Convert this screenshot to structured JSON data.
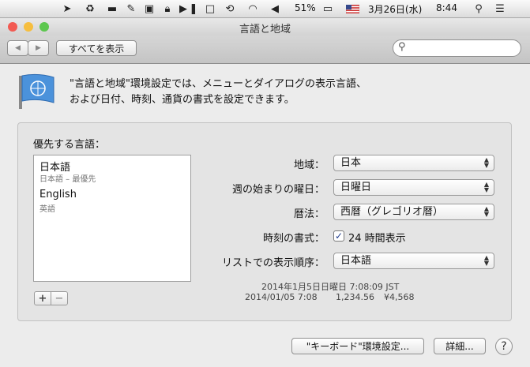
{
  "menubar": {
    "battery": "51%",
    "date": "3月26日(水)",
    "time": "8:44"
  },
  "window": {
    "title": "言語と地域"
  },
  "toolbar": {
    "show_all": "すべてを表示",
    "back_icon": "◀",
    "forward_icon": "▶"
  },
  "intro": {
    "line1": "\"言語と地域\"環境設定では、メニューとダイアログの表示言語、",
    "line2": "および日付、時刻、通貨の書式を設定できます。"
  },
  "languages": {
    "heading": "優先する言語：",
    "items": [
      {
        "name": "日本語",
        "sub": "日本語 – 最優先"
      },
      {
        "name": "English",
        "sub": "英語"
      }
    ],
    "add": "+",
    "remove": "−"
  },
  "settings": {
    "region_label": "地域：",
    "region_value": "日本",
    "week_label": "週の始まりの曜日：",
    "week_value": "日曜日",
    "calendar_label": "暦法：",
    "calendar_value": "西暦（グレゴリオ暦）",
    "time_format_label": "時刻の書式：",
    "time_format_value": "24 時間表示",
    "time_format_checked": true,
    "list_order_label": "リストでの表示順序：",
    "list_order_value": "日本語"
  },
  "sample": {
    "line1": "2014年1月5日日曜日 7:08:09 JST",
    "line2_date": "2014/01/05 7:08",
    "line2_number": "1,234.56",
    "line2_currency": "¥4,568"
  },
  "buttons": {
    "keyboard": "\"キーボード\"環境設定...",
    "advanced": "詳細...",
    "help": "?"
  },
  "colors": {
    "close": "#f25a52",
    "minimize": "#f6be3f",
    "zoom": "#5dc74f",
    "check": "#1f3b8c"
  }
}
